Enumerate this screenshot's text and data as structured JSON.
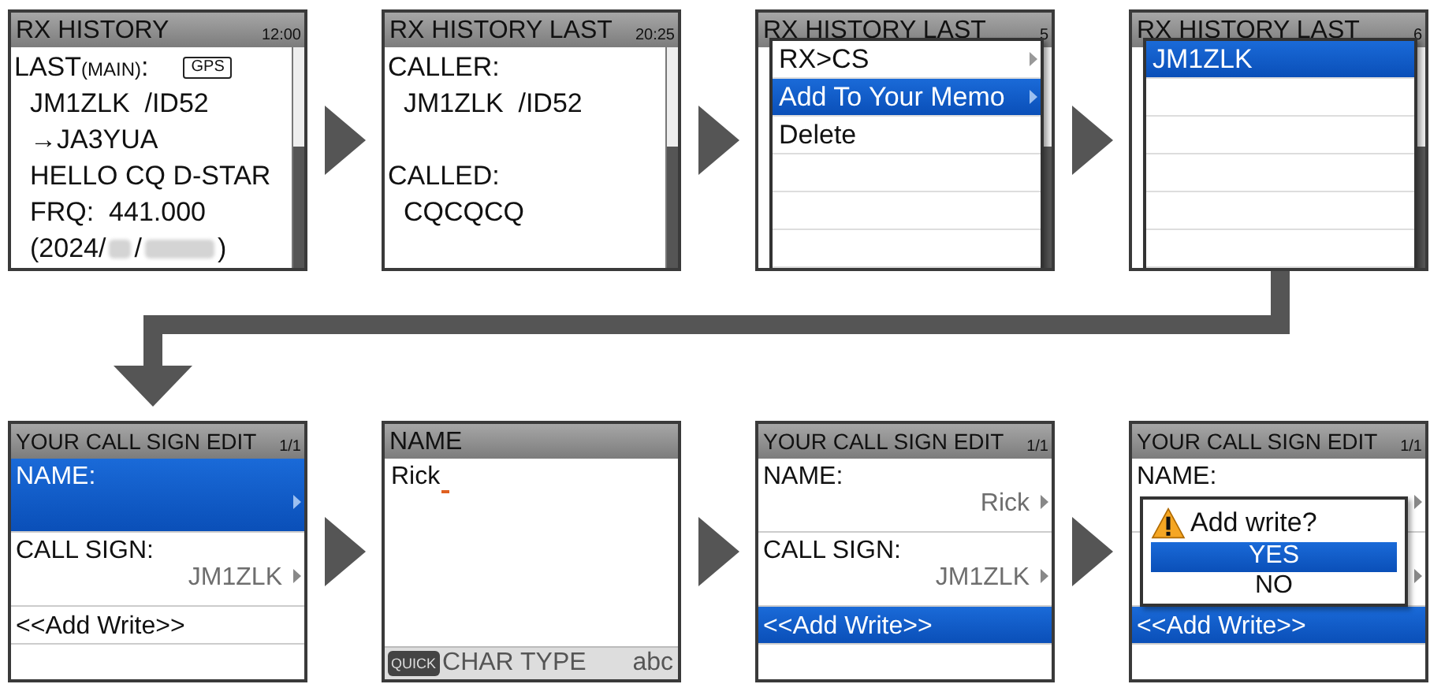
{
  "screens": [
    {
      "kind": "history",
      "title": "RX HISTORY",
      "time": "12:00",
      "lines": [
        {
          "kind": "heading",
          "text": "LAST",
          "sub": "(MAIN)",
          "after": ":",
          "badge": "GPS"
        },
        {
          "kind": "value",
          "text": "JM1ZLK  /ID52"
        },
        {
          "kind": "value",
          "text": "→JA3YUA"
        },
        {
          "kind": "value",
          "text": "HELLO CQ D-STAR"
        },
        {
          "kind": "value",
          "text": "FRQ:  441.000"
        },
        {
          "kind": "date",
          "prefix": "(2024/",
          "sep": "/",
          "suffix": ")"
        }
      ]
    },
    {
      "kind": "history",
      "title": "RX HISTORY LAST",
      "time": "20:25",
      "lines": [
        {
          "kind": "label",
          "text": "CALLER:"
        },
        {
          "kind": "value",
          "text": "JM1ZLK  /ID52"
        },
        {
          "kind": "blank"
        },
        {
          "kind": "label",
          "text": "CALLED:"
        },
        {
          "kind": "value",
          "text": "CQCQCQ"
        }
      ]
    },
    {
      "kind": "popup",
      "background": {
        "title": "RX HISTORY LAST",
        "time": "5"
      },
      "menu": [
        {
          "label": "RX>CS",
          "arrow": true,
          "selected": false
        },
        {
          "label": "Add To Your Memo",
          "arrow": true,
          "selected": true
        },
        {
          "label": "Delete",
          "arrow": false,
          "selected": false
        }
      ]
    },
    {
      "kind": "popup",
      "background": {
        "title": "RX HISTORY LAST",
        "time": "6"
      },
      "menu": [
        {
          "label": "JM1ZLK",
          "arrow": false,
          "selected": true
        }
      ]
    },
    {
      "kind": "edit",
      "title": "YOUR CALL SIGN EDIT",
      "page": "1/1",
      "rows": [
        {
          "kind": "field",
          "label": "NAME:",
          "selected": true
        },
        {
          "kind": "field",
          "label": "CALL SIGN:",
          "value": "JM1ZLK",
          "selected": false
        },
        {
          "kind": "action",
          "text": "<<Add Write>>",
          "selected": false
        }
      ]
    },
    {
      "kind": "input",
      "title": "NAME",
      "value": "Rick",
      "footer": {
        "key": "QUICK",
        "label": "CHAR TYPE",
        "mode": "abc"
      }
    },
    {
      "kind": "edit",
      "title": "YOUR CALL SIGN EDIT",
      "page": "1/1",
      "rows": [
        {
          "kind": "field",
          "label": "NAME:",
          "value": "Rick",
          "selected": false
        },
        {
          "kind": "field",
          "label": "CALL SIGN:",
          "value": "JM1ZLK",
          "selected": false
        },
        {
          "kind": "action",
          "text": "<<Add Write>>",
          "selected": true
        }
      ]
    },
    {
      "kind": "dialog",
      "background": {
        "title": "YOUR CALL SIGN EDIT",
        "page": "1/1",
        "rows": [
          {
            "kind": "field",
            "label": "NAME:",
            "selected": false
          },
          {
            "kind": "field",
            "selected": false
          },
          {
            "kind": "action",
            "text": "<<Add Write>>",
            "selected": true
          }
        ]
      },
      "dialog": {
        "message": "Add write?",
        "options": [
          {
            "label": "YES",
            "selected": true
          },
          {
            "label": "NO",
            "selected": false
          }
        ]
      }
    }
  ]
}
